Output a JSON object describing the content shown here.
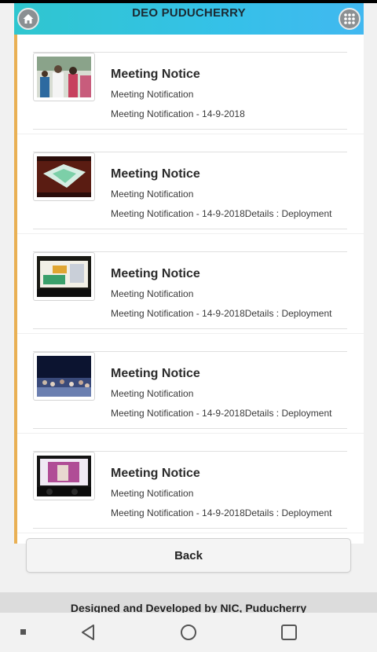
{
  "header": {
    "title": "DEO PUDUCHERRY",
    "home_icon": "home-icon",
    "apps_icon": "grid-icon"
  },
  "notices": [
    {
      "title": "Meeting Notice",
      "subtitle": "Meeting Notification",
      "detail": "Meeting Notification - 14-9-2018",
      "thumbnail": "meeting-photo"
    },
    {
      "title": "Meeting Notice",
      "subtitle": "Meeting Notification",
      "detail": "Meeting Notification - 14-9-2018Details : Deployment",
      "thumbnail": "screen-photo"
    },
    {
      "title": "Meeting Notice",
      "subtitle": "Meeting Notification",
      "detail": "Meeting Notification - 14-9-2018Details : Deployment",
      "thumbnail": "stage-banner-photo"
    },
    {
      "title": "Meeting Notice",
      "subtitle": "Meeting Notification",
      "detail": "Meeting Notification - 14-9-2018Details : Deployment",
      "thumbnail": "crowd-photo"
    },
    {
      "title": "Meeting Notice",
      "subtitle": "Meeting Notification",
      "detail": "Meeting Notification - 14-9-2018Details : Deployment",
      "thumbnail": "stage-screen-photo"
    }
  ],
  "back_label": "Back",
  "footer": {
    "text": "Designed and Developed by NIC, Puducherry"
  },
  "colors": {
    "header_start": "#2fc6cf",
    "header_end": "#41b8f0",
    "accent_border": "#e9b054"
  }
}
